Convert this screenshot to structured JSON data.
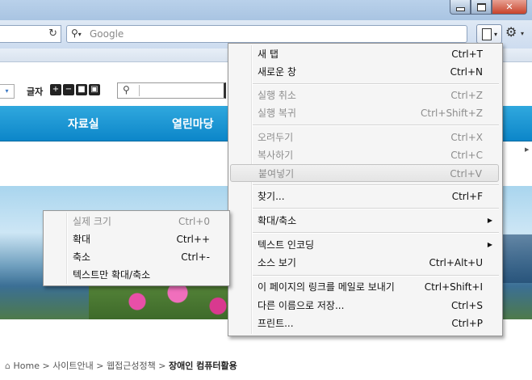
{
  "browser": {
    "search_placeholder": "Google",
    "icons": {
      "minimize": "minimize-icon",
      "maximize": "maximize-icon",
      "close": "close-icon",
      "reload": "reload-icon",
      "search": "search-icon",
      "page": "page-icon",
      "tools": "gear-icon"
    },
    "close_glyph": "✕",
    "reload_glyph": "↻",
    "gear_glyph": "⚙",
    "dropdown_glyph": "▾"
  },
  "site": {
    "font_size_label": "글자",
    "font_buttons": [
      "+",
      "−",
      "■",
      "▣"
    ],
    "nav": [
      "자료실",
      "열린마당"
    ],
    "breadcrumb": {
      "home": "Home",
      "items": [
        "사이트안내",
        "웹접근성정책"
      ],
      "current": "장애인 컴퓨터활용",
      "separator": ">"
    }
  },
  "context_menu": {
    "items": [
      {
        "label": "새 탭",
        "shortcut": "Ctrl+T",
        "enabled": true
      },
      {
        "label": "새로운 창",
        "shortcut": "Ctrl+N",
        "enabled": true
      },
      {
        "label": "실행 취소",
        "shortcut": "Ctrl+Z",
        "enabled": false
      },
      {
        "label": "실행 복귀",
        "shortcut": "Ctrl+Shift+Z",
        "enabled": false
      },
      {
        "label": "오려두기",
        "shortcut": "Ctrl+X",
        "enabled": false
      },
      {
        "label": "복사하기",
        "shortcut": "Ctrl+C",
        "enabled": false
      },
      {
        "label": "붙여넣기",
        "shortcut": "Ctrl+V",
        "enabled": false,
        "highlighted": true
      },
      {
        "label": "찾기...",
        "shortcut": "Ctrl+F",
        "enabled": true
      },
      {
        "label": "확대/축소",
        "shortcut": "",
        "enabled": true,
        "submenu": true
      },
      {
        "label": "텍스트 인코딩",
        "shortcut": "",
        "enabled": true,
        "submenu": true
      },
      {
        "label": "소스 보기",
        "shortcut": "Ctrl+Alt+U",
        "enabled": true
      },
      {
        "label": "이 페이지의 링크를 메일로 보내기",
        "shortcut": "Ctrl+Shift+I",
        "enabled": true
      },
      {
        "label": "다른 이름으로 저장...",
        "shortcut": "Ctrl+S",
        "enabled": true
      },
      {
        "label": "프린트...",
        "shortcut": "Ctrl+P",
        "enabled": true
      }
    ],
    "submenu_arrow": "▶"
  },
  "zoom_menu": {
    "items": [
      {
        "label": "실제 크기",
        "shortcut": "Ctrl+0",
        "enabled": false
      },
      {
        "label": "확대",
        "shortcut": "Ctrl++",
        "enabled": true
      },
      {
        "label": "축소",
        "shortcut": "Ctrl+-",
        "enabled": true
      },
      {
        "label": "텍스트만 확대/축소",
        "shortcut": "",
        "enabled": true
      }
    ]
  }
}
